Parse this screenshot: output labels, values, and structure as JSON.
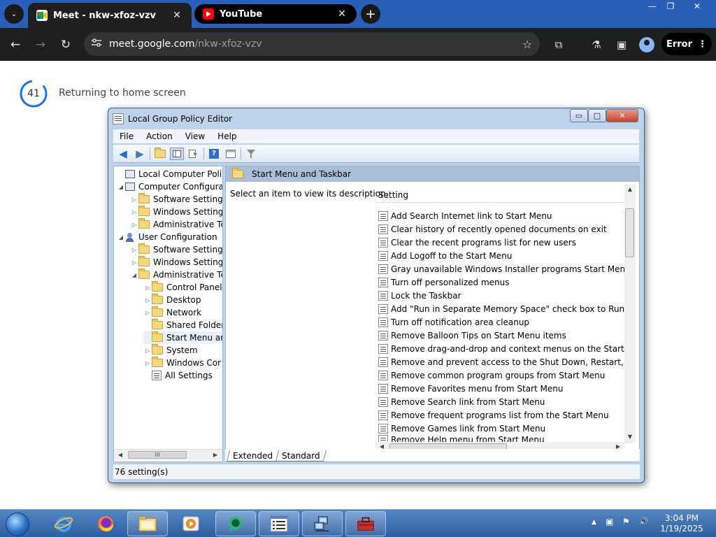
{
  "browser": {
    "tabs": [
      {
        "title": "Meet - nkw-xfoz-vzv",
        "close": "✕",
        "active": true
      },
      {
        "title": "YouTube",
        "close": "✕",
        "active": false
      }
    ],
    "new_tab": "+",
    "tab_search": "⌄",
    "window_controls": {
      "minimize": "—",
      "restore": "❐",
      "close": "✕"
    },
    "url_host": "meet.google.com",
    "url_path": "/nkw-xfoz-vzv",
    "error_label": "Error",
    "icons": {
      "back": "←",
      "forward": "→",
      "reload": "↻",
      "star": "☆",
      "extensions": "⧉",
      "labs": "⚗",
      "sidepanel": "▣",
      "menu": "⋮"
    }
  },
  "meet": {
    "countdown": "41",
    "message": "Returning to home screen"
  },
  "gpo": {
    "title": "Local Group Policy Editor",
    "menu": [
      "File",
      "Action",
      "View",
      "Help"
    ],
    "tree": [
      {
        "label": "Local Computer Policy",
        "level": 0,
        "icon": "computer",
        "exp": ""
      },
      {
        "label": "Computer Configura",
        "level": 0,
        "icon": "computer",
        "exp": "◢"
      },
      {
        "label": "Software Settings",
        "level": 1,
        "icon": "folder",
        "exp": "▷"
      },
      {
        "label": "Windows Setting",
        "level": 1,
        "icon": "folder",
        "exp": "▷"
      },
      {
        "label": "Administrative Te",
        "level": 1,
        "icon": "folder",
        "exp": "▷"
      },
      {
        "label": "User Configuration",
        "level": 0,
        "icon": "user",
        "exp": "◢"
      },
      {
        "label": "Software Settings",
        "level": 1,
        "icon": "folder",
        "exp": "▷"
      },
      {
        "label": "Windows Setting",
        "level": 1,
        "icon": "folder",
        "exp": "▷"
      },
      {
        "label": "Administrative Te",
        "level": 1,
        "icon": "folder",
        "exp": "◢"
      },
      {
        "label": "Control Panel",
        "level": 2,
        "icon": "folder",
        "exp": "▷"
      },
      {
        "label": "Desktop",
        "level": 2,
        "icon": "folder",
        "exp": "▷"
      },
      {
        "label": "Network",
        "level": 2,
        "icon": "folder",
        "exp": "▷"
      },
      {
        "label": "Shared Folder",
        "level": 2,
        "icon": "folder",
        "exp": ""
      },
      {
        "label": "Start Menu ar",
        "level": 2,
        "icon": "folder",
        "exp": "",
        "selected": true
      },
      {
        "label": "System",
        "level": 2,
        "icon": "folder",
        "exp": "▷"
      },
      {
        "label": "Windows Cor",
        "level": 2,
        "icon": "folder",
        "exp": "▷"
      },
      {
        "label": "All Settings",
        "level": 2,
        "icon": "settings",
        "exp": ""
      }
    ],
    "section_title": "Start Menu and Taskbar",
    "description": "Select an item to view its description.",
    "column_header": "Setting",
    "settings": [
      "Add Search Internet link to Start Menu",
      "Clear history of recently opened documents on exit",
      "Clear the recent programs list for new users",
      "Add Logoff to the Start Menu",
      "Gray unavailable Windows Installer programs Start Menu sh...",
      "Turn off personalized menus",
      "Lock the Taskbar",
      "Add \"Run in Separate Memory Space\" check box to Run dial...",
      "Turn off notification area cleanup",
      "Remove Balloon Tips on Start Menu items",
      "Remove drag-and-drop and context menus on the Start Me...",
      "Remove and prevent access to the Shut Down, Restart, Sleep...",
      "Remove common program groups from Start Menu",
      "Remove Favorites menu from Start Menu",
      "Remove Search link from Start Menu",
      "Remove frequent programs list from the Start Menu",
      "Remove Games link from Start Menu",
      "Remove Help menu from Start Menu"
    ],
    "tabs": [
      "Extended",
      "Standard"
    ],
    "status": "76 setting(s)",
    "caption_buttons": {
      "minimize": "▭",
      "maximize": "□",
      "close": "✕"
    },
    "scroll_grip": "III"
  },
  "taskbar": {
    "time": "3:04 PM",
    "date": "1/19/2025",
    "tray_icons": {
      "show_hidden": "▲",
      "network": "▣",
      "flag": "⚑",
      "volume": "🔊"
    }
  }
}
